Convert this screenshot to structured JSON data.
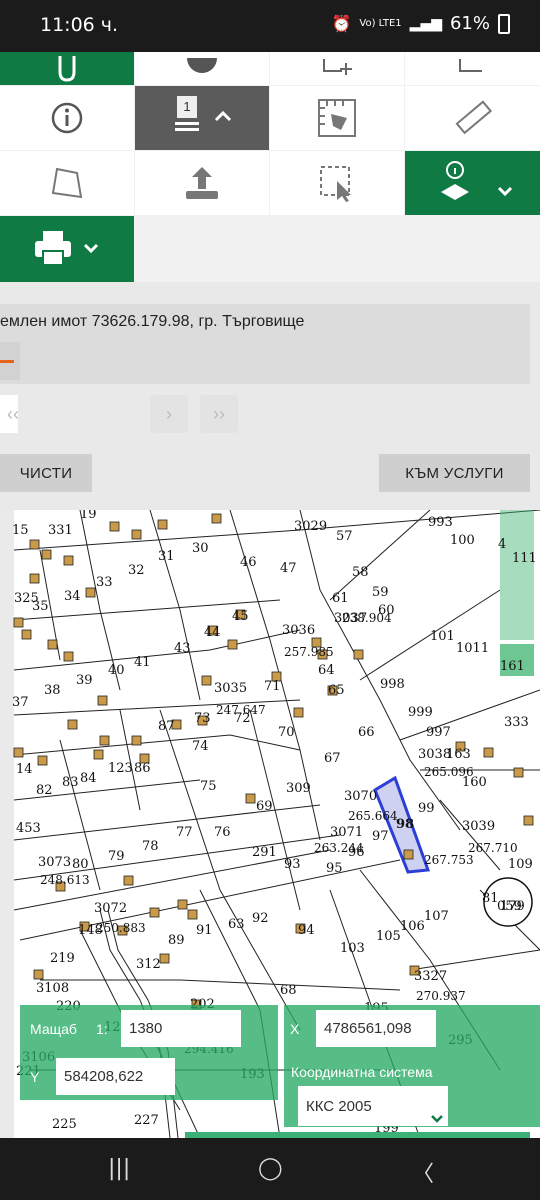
{
  "status_bar": {
    "time": "11:06 ч.",
    "network": "Vo) LTE1",
    "battery": "61%"
  },
  "toolbar": {
    "print_label": "",
    "layers_page": "1"
  },
  "panel": {
    "title": "емлен имот 73626.179.98, гр. Търговище",
    "clear_label": "ЧИСТИ",
    "services_label": "КЪМ УСЛУГИ",
    "prev_glyph": "‹‹",
    "next_glyph": "›",
    "last_glyph": "››"
  },
  "map": {
    "parcel_numbers": [
      "15",
      "331",
      "19",
      "30",
      "31",
      "32",
      "33",
      "34",
      "35",
      "325",
      "46",
      "47",
      "3029",
      "57",
      "993",
      "100",
      "4",
      "111",
      "58",
      "59",
      "60",
      "61",
      "3037",
      "238.904",
      "44",
      "45",
      "43",
      "41",
      "40",
      "39",
      "38",
      "37",
      "3036",
      "257.985",
      "64",
      "71",
      "65",
      "3035",
      "247.647",
      "72",
      "73",
      "74",
      "87",
      "86",
      "123",
      "83",
      "84",
      "82",
      "75",
      "70",
      "67",
      "66",
      "998",
      "999",
      "997",
      "3038",
      "163",
      "265.096",
      "160",
      "333",
      "101",
      "1011",
      "161",
      "69",
      "309",
      "3070",
      "265.664",
      "98",
      "99",
      "97",
      "96",
      "3039",
      "267.710",
      "267.753",
      "95",
      "93",
      "3071",
      "263.244",
      "291",
      "76",
      "77",
      "78",
      "79",
      "80",
      "3073",
      "248.613",
      "109",
      "81",
      "179",
      "3072",
      "250.883",
      "148",
      "89",
      "91",
      "63",
      "92",
      "94",
      "103",
      "105",
      "106",
      "107",
      "219",
      "312",
      "68",
      "3108",
      "3327",
      "270.937",
      "220",
      "195",
      "225",
      "227",
      "199",
      "202",
      "193",
      "295",
      "12",
      "294.416",
      "3106",
      "221",
      "14",
      "453",
      "059"
    ],
    "highlighted_parcel": "98"
  },
  "scale": {
    "label": "Мащаб",
    "prefix": "1:",
    "value": "1380"
  },
  "coords": {
    "x_label": "X",
    "x_value": "4786561,098",
    "y_label": "Y",
    "y_value": "584208,622",
    "system_label": "Координатна система",
    "system_value": "ККС 2005"
  },
  "colors": {
    "green": "#0f7a43",
    "overlay_green": "#28aa64",
    "parcel_highlight": "#2b3fd6",
    "building": "#c89a4a"
  }
}
